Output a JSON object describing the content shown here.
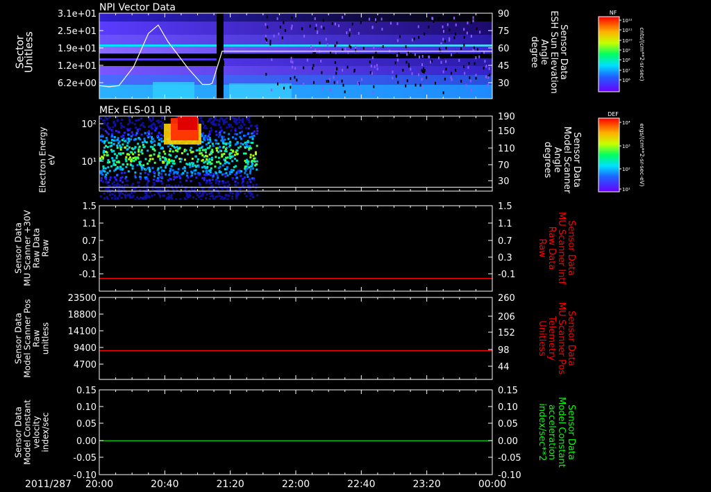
{
  "x_axis": {
    "date_label": "2011/287",
    "ticks": [
      "20:00",
      "20:40",
      "21:20",
      "22:00",
      "22:40",
      "23:20",
      "00:00"
    ],
    "range_hours": [
      20,
      24
    ]
  },
  "colorbars": [
    {
      "name": "NF",
      "unit_label": "cnts/(cm**2-sr-sec)",
      "ticks": [
        "10¹²",
        "10¹¹",
        "10¹⁰",
        "10⁹",
        "10⁸",
        "10⁷",
        "10⁶"
      ]
    },
    {
      "name": "DEF",
      "unit_label": "ergs/(cm**2-sr-sec-eV)",
      "ticks": [
        "10⁴",
        "10³",
        "10²",
        "10¹"
      ]
    }
  ],
  "chart_data": [
    {
      "type": "heatmap",
      "title": "NPI Vector Data",
      "ylabel": [
        "Sector",
        "Unitless"
      ],
      "yticks": [
        "3.1e+01",
        "2.5e+01",
        "1.9e+01",
        "1.2e+01",
        "6.2e+00"
      ],
      "ylim": [
        0,
        31
      ],
      "y2label": [
        "Sensor Data",
        "ESH Sun Elevation",
        "Angle",
        "degree"
      ],
      "y2ticks": [
        "90",
        "75",
        "60",
        "45",
        "30"
      ],
      "y2_color": "#ffffff",
      "overlay_series": {
        "name": "ESH Sun Elevation Angle",
        "x": [
          20.0,
          20.1,
          20.2,
          20.35,
          20.5,
          20.6,
          20.7,
          20.9,
          21.05,
          21.1,
          21.12,
          21.15,
          21.25,
          21.5,
          22.0,
          23.0,
          24.0
        ],
        "y": [
          29,
          28,
          29,
          45,
          73,
          80,
          66,
          44,
          30,
          30,
          30,
          31,
          58,
          58,
          58,
          58,
          58
        ],
        "ylim": [
          18,
          90
        ]
      }
    },
    {
      "type": "heatmap",
      "title": "MEx ELS-01 LR",
      "ylabel": [
        "Electron Energy",
        "eV"
      ],
      "yticks": [
        "10²",
        "10¹"
      ],
      "ylim": [
        1,
        300
      ],
      "y2label": [
        "Sensor Data",
        "Model Scanner",
        "Angle",
        "degrees"
      ],
      "y2ticks": [
        "190",
        "150",
        "110",
        "70",
        "30"
      ],
      "y2_color": "#ffffff",
      "data_extent_hours": [
        20.0,
        21.6
      ],
      "overlay_series": {
        "name": "Model Scanner Angle",
        "x": [
          20.0,
          24.0
        ],
        "y": [
          10,
          10
        ],
        "ylim": [
          0,
          190
        ]
      }
    },
    {
      "type": "line",
      "ylabel": [
        "Sensor Data",
        "MU Scanner +30V",
        "Raw Data",
        "Raw"
      ],
      "yticks": [
        "1.5",
        "1.1",
        "0.7",
        "0.3",
        "-0.1"
      ],
      "ylim": [
        -0.3,
        1.5
      ],
      "y2label": [
        "Sensor Data",
        "MU Scanner Intf",
        "Raw Data",
        "Raw"
      ],
      "y2ticks": [
        "1.5",
        "1.1",
        "0.7",
        "0.3",
        "-0.1"
      ],
      "y2_color": "#ff0000",
      "series": [
        {
          "x": [
            20.0,
            24.0
          ],
          "y": [
            -0.03,
            -0.03
          ],
          "color": "#ff0000"
        }
      ]
    },
    {
      "type": "line",
      "ylabel": [
        "Sensor Data",
        "Model Scanner Pos",
        "Raw",
        "unitless"
      ],
      "yticks": [
        "23500",
        "18800",
        "14100",
        "9400",
        "4700"
      ],
      "ylim": [
        0,
        23500
      ],
      "y2label": [
        "Sensor Data",
        "MU Scanner Pos",
        "Telemetry",
        "Unitless"
      ],
      "y2ticks": [
        "260",
        "206",
        "152",
        "98",
        "44"
      ],
      "y2_color": "#ff0000",
      "series": [
        {
          "x": [
            20.0,
            24.0
          ],
          "y": [
            8270,
            8270
          ],
          "color": "#ff0000"
        }
      ]
    },
    {
      "type": "line",
      "ylabel": [
        "Sensor Data",
        "Model Constant",
        "velocity",
        "index/sec"
      ],
      "yticks": [
        "0.15",
        "0.10",
        "0.05",
        "0.00",
        "-0.05",
        "-0.10"
      ],
      "ylim": [
        -0.1,
        0.15
      ],
      "y2label": [
        "Sensor Data",
        "Model Constant",
        "acceleration",
        "index/sec**2"
      ],
      "y2ticks": [
        "0.15",
        "0.10",
        "0.05",
        "0.00",
        "-0.05",
        "-0.10"
      ],
      "y2_color": "#00ff00",
      "series": [
        {
          "x": [
            20.0,
            24.0
          ],
          "y": [
            0.0,
            0.0
          ],
          "color": "#00ff00"
        }
      ]
    }
  ]
}
